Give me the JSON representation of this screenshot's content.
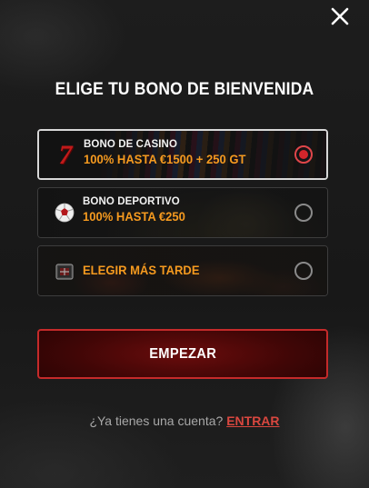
{
  "modal": {
    "title": "ELIGE TU BONO DE BIENVENIDA",
    "close_icon": "close-icon"
  },
  "options": [
    {
      "label": "BONO DE CASINO",
      "value": "100% HASTA €1500 + 250 GT",
      "icon": "lucky-seven-icon",
      "icon_text": "7",
      "selected": true
    },
    {
      "label": "BONO DEPORTIVO",
      "value": "100% HASTA €250",
      "icon": "football-icon",
      "selected": false
    },
    {
      "label": "",
      "value": "ELEGIR MÁS TARDE",
      "icon": "gift-box-icon",
      "selected": false
    }
  ],
  "start_button": {
    "label": "EMPEZAR"
  },
  "footer": {
    "question": "¿Ya tienes una cuenta?",
    "login_link": "ENTRAR"
  },
  "colors": {
    "background": "#1b1b1b",
    "accent_orange": "#f59a1f",
    "accent_red": "#d3252b",
    "button_border": "#c52a2a",
    "link_red": "#d9473f"
  }
}
